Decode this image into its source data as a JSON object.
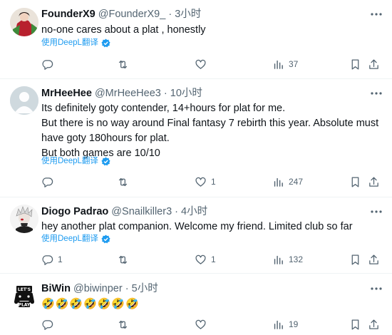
{
  "tweets": [
    {
      "name": "FounderX9",
      "handle": "@FounderX9_",
      "separator": "·",
      "time": "3小时",
      "text_lines": [
        "no-one cares about a plat , honestly"
      ],
      "translate_label": "使用DeepL翻译",
      "reply_count": "",
      "retweet_count": "",
      "like_count": "",
      "views": "37"
    },
    {
      "name": "MrHeeHee",
      "handle": "@MrHeeHee3",
      "separator": "·",
      "time": "10小时",
      "text_lines": [
        "Its definitely goty contender, 14+hours for plat for me.",
        "But there is no way around Final fantasy 7 rebirth this year. Absolute must",
        "have goty 180hours for plat.",
        "But both games are 10/10"
      ],
      "translate_label": "使用DeepL翻译",
      "reply_count": "",
      "retweet_count": "",
      "like_count": "1",
      "views": "247"
    },
    {
      "name": "Diogo Padrao",
      "handle": "@Snailkiller3",
      "separator": "·",
      "time": "4小时",
      "text_lines": [
        "hey another plat companion. Welcome my friend. Limited club so far"
      ],
      "translate_label": "使用DeepL翻译",
      "reply_count": "1",
      "retweet_count": "",
      "like_count": "1",
      "views": "132"
    },
    {
      "name": "BiWin",
      "handle": "@biwinper",
      "separator": "·",
      "time": "5小时",
      "text_lines": [
        "🤣🤣🤣🤣🤣🤣🤣"
      ],
      "translate_label": "",
      "reply_count": "",
      "retweet_count": "",
      "like_count": "",
      "views": "19"
    }
  ],
  "avatar4_text": [
    "LET'S",
    "PLAY"
  ],
  "icons": {
    "more": "more-icon",
    "reply": "reply-icon",
    "retweet": "retweet-icon",
    "like": "heart-icon",
    "views": "views-icon",
    "bookmark": "bookmark-icon",
    "share": "share-icon",
    "deepl": "deepl-badge-icon"
  },
  "colors": {
    "text": "#0f1419",
    "secondary": "#536471",
    "link": "#1d9bf0",
    "divider": "#eff3f4"
  }
}
